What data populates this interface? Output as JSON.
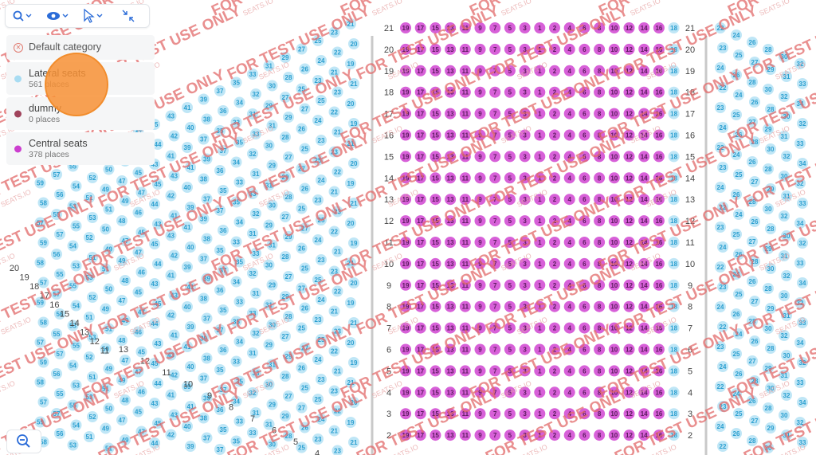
{
  "toolbar": {
    "tools": [
      {
        "name": "search-tool",
        "icon": "magnifier-icon"
      },
      {
        "name": "view-tool",
        "icon": "eye-icon"
      },
      {
        "name": "select-tool",
        "icon": "pointer-icon"
      },
      {
        "name": "collapse-tool",
        "icon": "collapse-arrows-icon"
      }
    ]
  },
  "legend": {
    "default_category": "Default category",
    "categories": [
      {
        "label": "Lateral seats",
        "count": "561 places",
        "color": "#a8dcf2"
      },
      {
        "label": "dummy",
        "count": "0 places",
        "color": "#a0445c"
      },
      {
        "label": "Central seats",
        "count": "378 places",
        "color": "#cc3fcf"
      }
    ]
  },
  "watermark": {
    "main": "FOR TEST USE ONLY",
    "sub": "SEATS.IO"
  },
  "center_rows": [
    "21",
    "20",
    "19",
    "18",
    "17",
    "16",
    "15",
    "14",
    "13",
    "12",
    "11",
    "10",
    "9",
    "8",
    "7",
    "6",
    "5",
    "4",
    "3",
    "2"
  ],
  "center_seats": [
    "19",
    "17",
    "15",
    "13",
    "11",
    "9",
    "7",
    "5",
    "3",
    "1",
    "2",
    "4",
    "6",
    "8",
    "10",
    "12",
    "14",
    "16",
    "18"
  ],
  "left_row_labels": [
    "20",
    "19",
    "18",
    "17",
    "16",
    "15",
    "14",
    "13",
    "12",
    "11",
    "10",
    "9",
    "8",
    "7",
    "6",
    "5",
    "4"
  ],
  "colors": {
    "central": "#d760d8",
    "lateral": "#bfe6f6",
    "lateral_text": "#2b9fd0",
    "row_label": "#444444",
    "watermark": "#e26a6a"
  }
}
